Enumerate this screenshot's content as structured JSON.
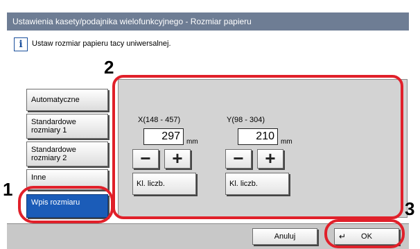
{
  "window": {
    "title": "Ustawienia kasety/podajnika wielofunkcyjnego - Rozmiar papieru"
  },
  "message": {
    "icon": "info-icon",
    "text": "Ustaw rozmiar papieru tacy uniwersalnej."
  },
  "size_options": [
    {
      "label": "Automatyczne",
      "selected": false
    },
    {
      "label": "Standardowe rozmiary 1",
      "selected": false
    },
    {
      "label": "Standardowe rozmiary 2",
      "selected": false
    },
    {
      "label": "Inne",
      "selected": false
    },
    {
      "label": "Wpis rozmiaru",
      "selected": true
    }
  ],
  "x_dim": {
    "label": "X(148 - 457)",
    "value": "297",
    "unit": "mm",
    "minus": "−",
    "plus": "+",
    "keypad": "Kl. liczb."
  },
  "y_dim": {
    "label": "Y(98 - 304)",
    "value": "210",
    "unit": "mm",
    "minus": "−",
    "plus": "+",
    "keypad": "Kl. liczb."
  },
  "footer": {
    "cancel": "Anuluj",
    "ok": "OK",
    "ok_icon": "return-arrow-icon"
  },
  "callouts": {
    "c1": "1",
    "c2": "2",
    "c3": "3"
  },
  "colors": {
    "titlebar": "#6e7d94",
    "selected": "#1b5cb8",
    "callout": "#e0202a",
    "panel": "#d3d3d3"
  }
}
